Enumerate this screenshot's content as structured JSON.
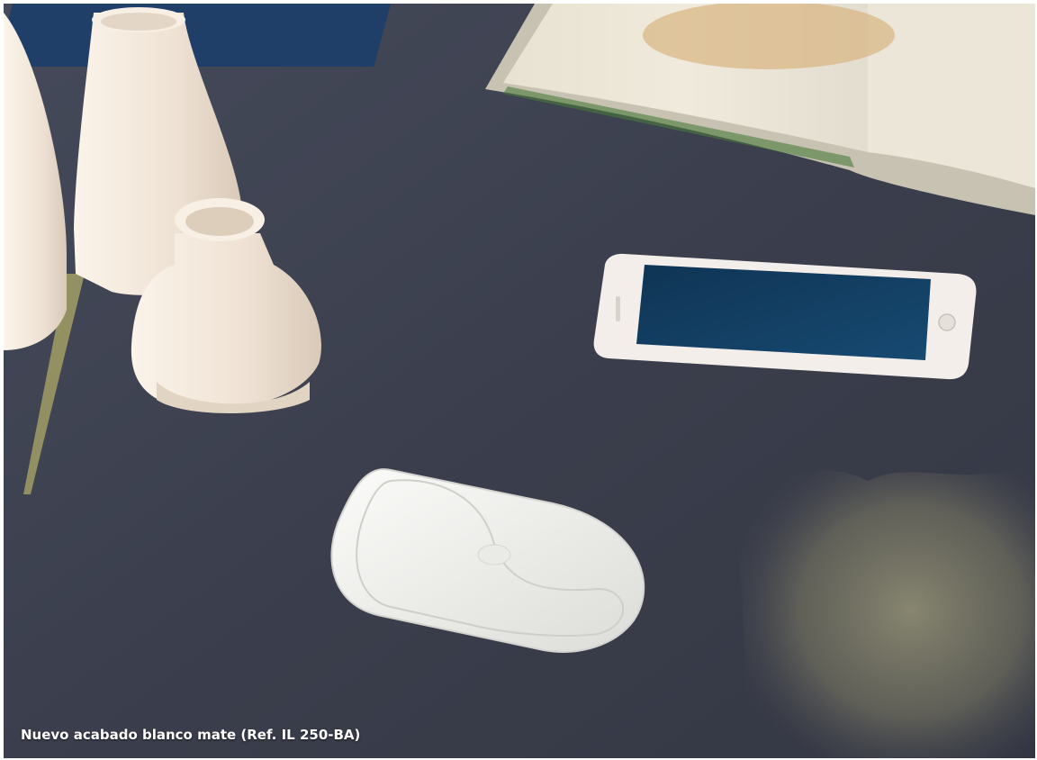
{
  "caption": "Nuevo acabado blanco mate (Ref. IL 250-BA)",
  "scene": {
    "objects": [
      "white-vases",
      "open-book",
      "smartphone",
      "desk-grommet-plate"
    ],
    "colors": {
      "table": "#3d4150",
      "vase": "#f1e8de",
      "phone_screen": "#123a5c",
      "grommet": "#efefed"
    }
  }
}
